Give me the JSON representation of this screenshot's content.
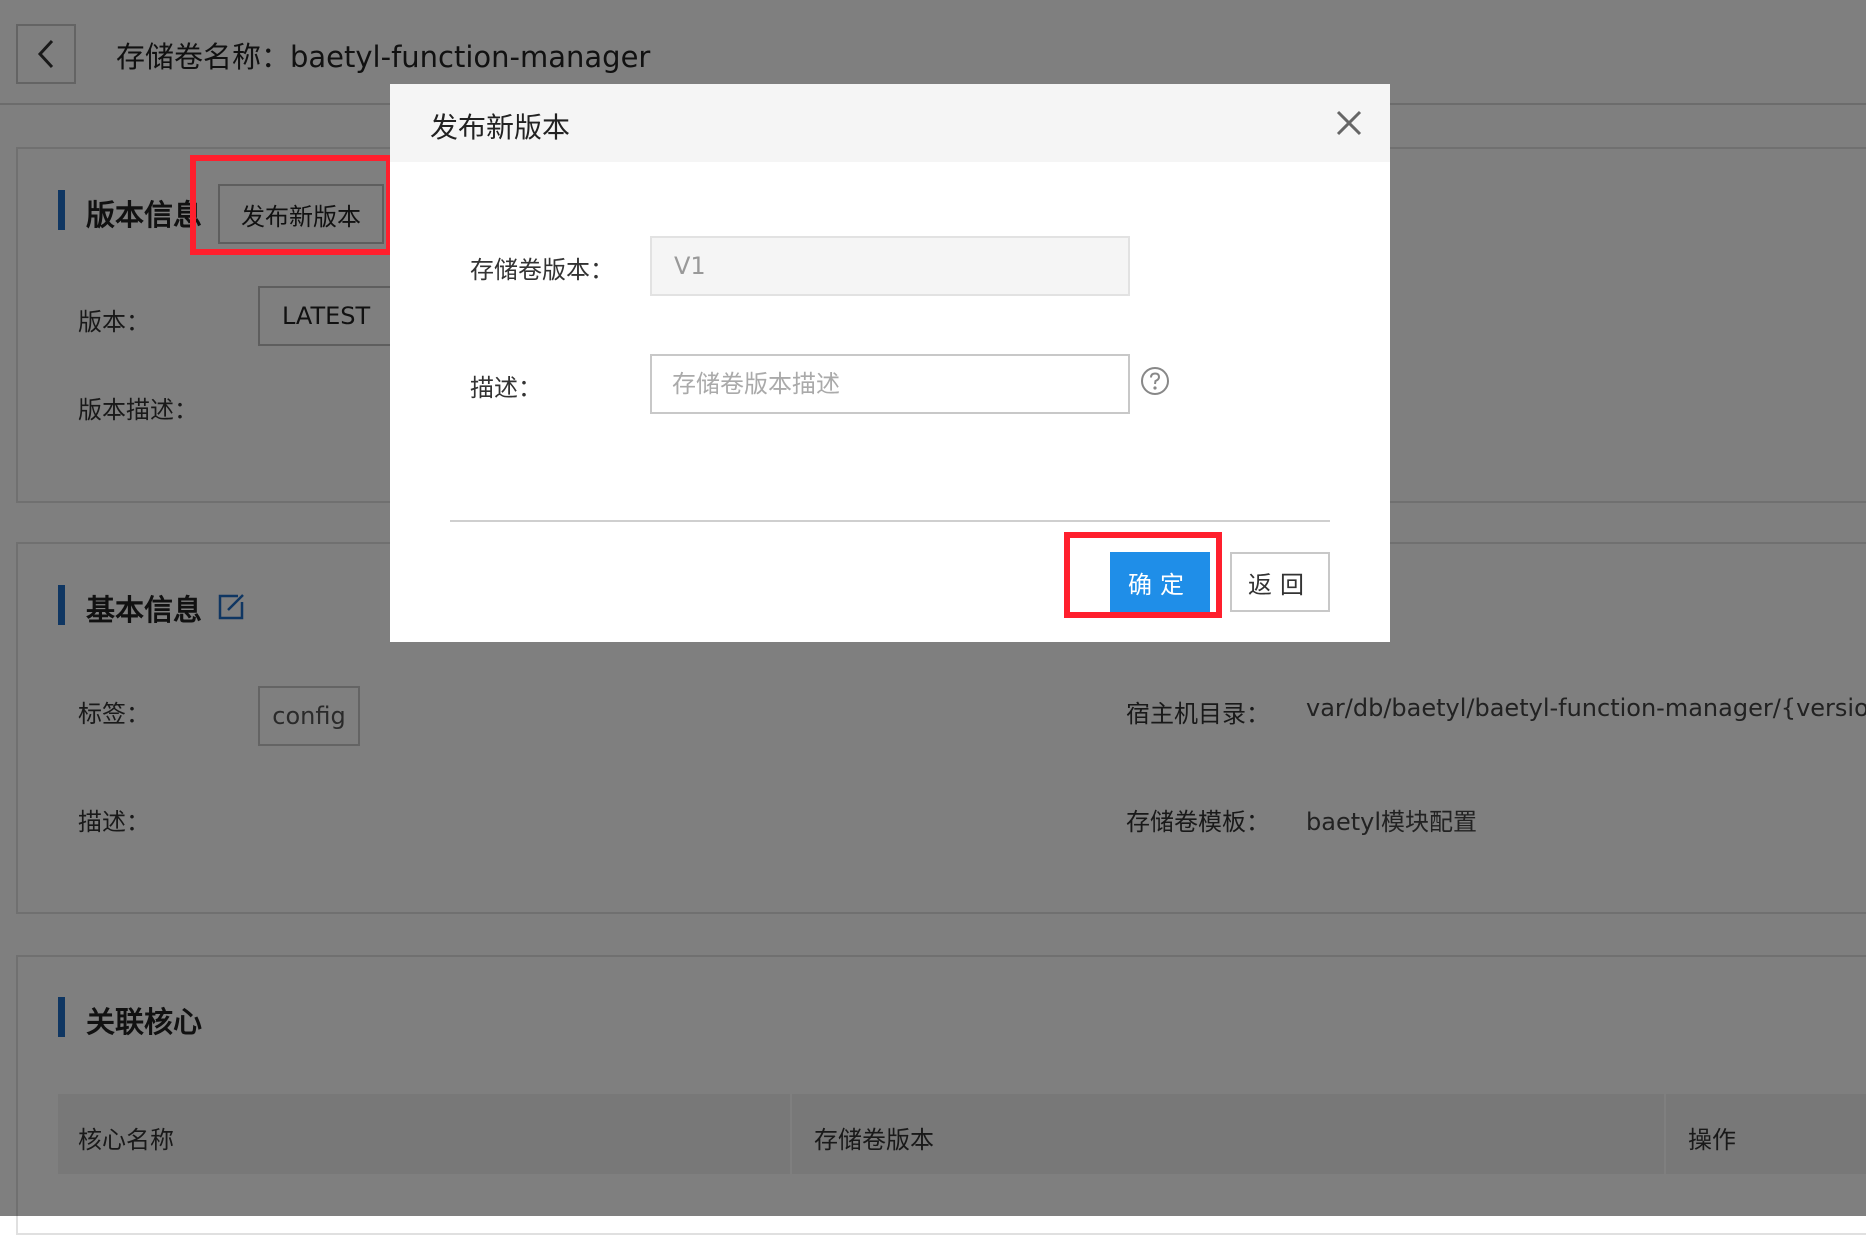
{
  "header": {
    "title": "存储卷名称：baetyl-function-manager"
  },
  "version_section": {
    "title": "版本信息",
    "publish_button": "发布新版本",
    "version_label": "版本：",
    "version_value": "LATEST",
    "description_label": "版本描述："
  },
  "basic_section": {
    "title": "基本信息",
    "tags_label": "标签：",
    "tag_value": "config",
    "description_label": "描述：",
    "host_dir_label": "宿主机目录：",
    "host_dir_value": "var/db/baetyl/baetyl-function-manager/{version}",
    "template_label": "存储卷模板：",
    "template_value": "baetyl模块配置"
  },
  "core_section": {
    "title": "关联核心",
    "columns": [
      "核心名称",
      "存储卷版本",
      "操作"
    ]
  },
  "dialog": {
    "title": "发布新版本",
    "version_label": "存储卷版本：",
    "version_value": "V1",
    "description_label": "描述：",
    "description_placeholder": "存储卷版本描述",
    "ok_button": "确定",
    "back_button": "返回"
  },
  "colors": {
    "accent": "#1f8ee8",
    "section_bar": "#1f6cc4",
    "highlight": "#ff1f2d"
  }
}
